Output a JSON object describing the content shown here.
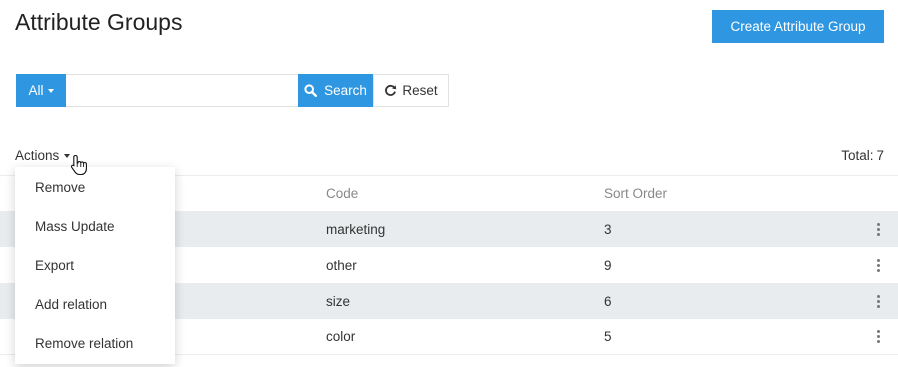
{
  "header": {
    "title": "Attribute Groups",
    "create_label": "Create Attribute Group"
  },
  "search": {
    "filter_label": "All",
    "value": "",
    "search_label": "Search",
    "reset_label": "Reset"
  },
  "toolbar": {
    "actions_label": "Actions",
    "total_label": "Total:",
    "total_count": "7"
  },
  "actions_menu": [
    {
      "label": "Remove"
    },
    {
      "label": "Mass Update"
    },
    {
      "label": "Export"
    },
    {
      "label": "Add relation"
    },
    {
      "label": "Remove relation"
    }
  ],
  "table": {
    "columns": [
      "Code",
      "Sort Order"
    ],
    "rows": [
      {
        "code": "marketing",
        "sort_order": "3"
      },
      {
        "code": "other",
        "sort_order": "9"
      },
      {
        "code": "size",
        "sort_order": "6"
      },
      {
        "code": "color",
        "sort_order": "5"
      }
    ]
  },
  "colors": {
    "accent": "#2f96e1",
    "row_shade": "#e9ecee"
  },
  "icons": [
    "chevron-down-icon",
    "search-icon",
    "refresh-icon",
    "hand-pointer-icon",
    "kebab-menu-icon"
  ]
}
